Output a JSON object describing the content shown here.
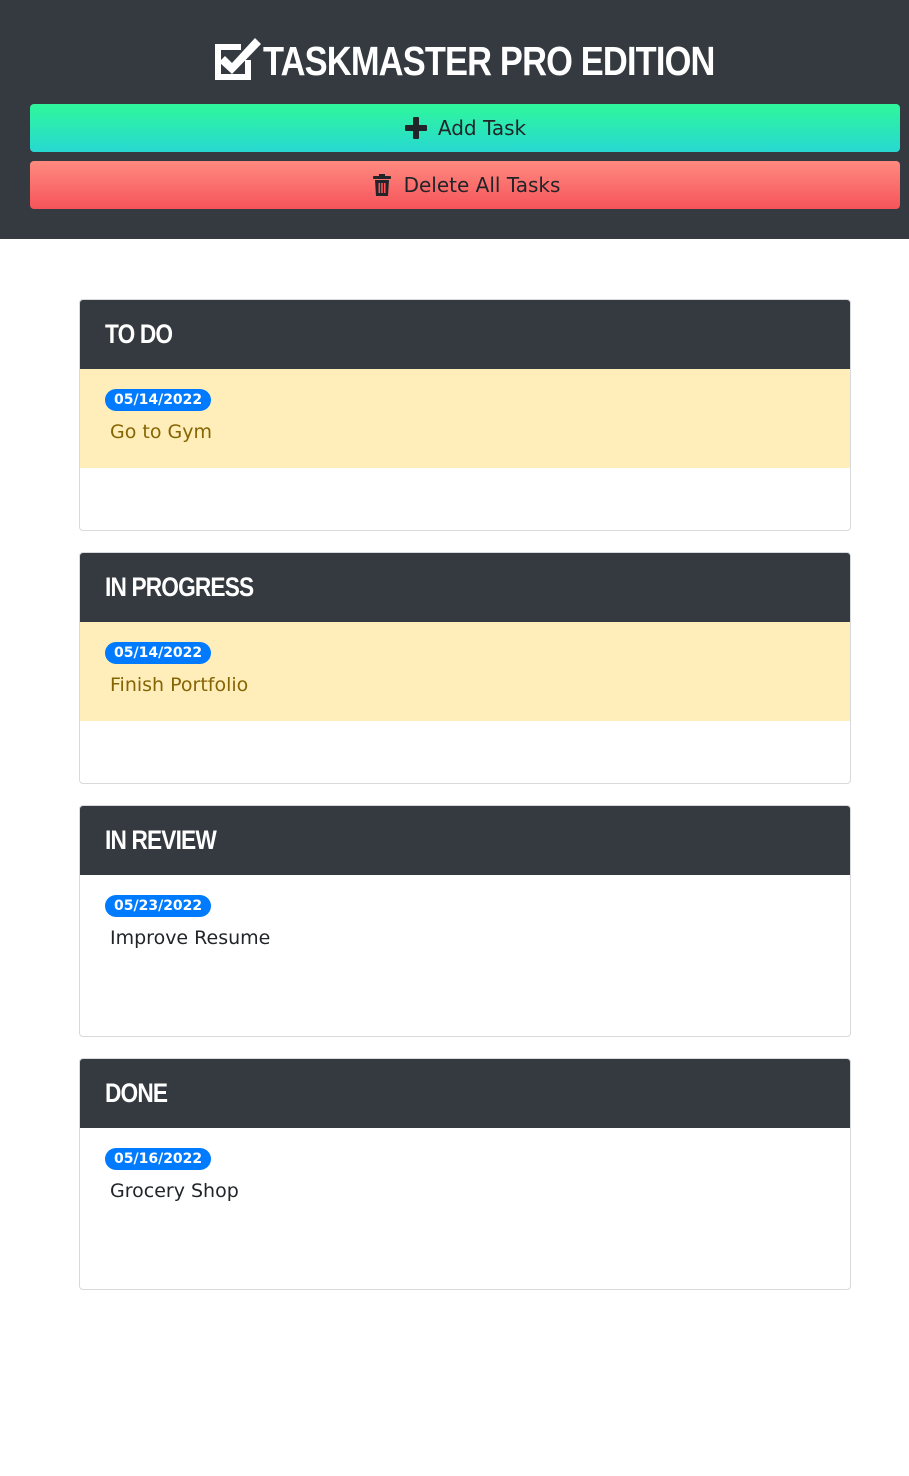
{
  "header": {
    "title": "Taskmaster Pro Edition",
    "brand_icon": "check-square-icon",
    "add_button": {
      "label": "Add Task",
      "icon": "plus-icon"
    },
    "delete_button": {
      "label": "Delete All Tasks",
      "icon": "trash-icon"
    }
  },
  "columns": [
    {
      "title": "To Do",
      "tasks": [
        {
          "date": "05/14/2022",
          "text": "Go to Gym",
          "status": "warning"
        }
      ]
    },
    {
      "title": "In Progress",
      "tasks": [
        {
          "date": "05/14/2022",
          "text": "Finish Portfolio",
          "status": "warning"
        }
      ]
    },
    {
      "title": "In Review",
      "tasks": [
        {
          "date": "05/23/2022",
          "text": "Improve Resume",
          "status": "plain"
        }
      ]
    },
    {
      "title": "Done",
      "tasks": [
        {
          "date": "05/16/2022",
          "text": "Grocery Shop",
          "status": "plain"
        }
      ]
    }
  ],
  "colors": {
    "header_bg": "#343a40",
    "badge_bg": "#007bff",
    "warning_bg": "#ffeeba",
    "add_gradient_top": "#2ff79b",
    "add_gradient_bottom": "#27d8d1",
    "delete_gradient_top": "#ff8a80",
    "delete_gradient_bottom": "#f6545a"
  }
}
